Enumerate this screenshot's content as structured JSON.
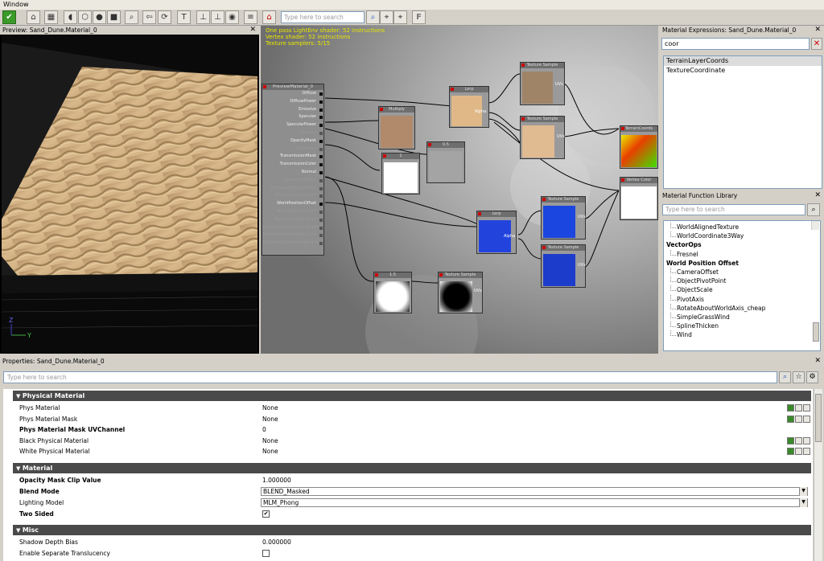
{
  "menu": {
    "window": "Window"
  },
  "toolbar": {
    "search_placeholder": "Type here to search",
    "f_label": "F"
  },
  "preview": {
    "title": "Preview: Sand_Dune.Material_0",
    "axis_y": "Y",
    "axis_z": "Z"
  },
  "graph": {
    "stats": [
      "One pass LightEnv shader: 52 instructions",
      "Vertex shader: 52 instructions",
      "Texture samplers: 5/15"
    ],
    "main_node": {
      "title": "PreviewMaterial_0",
      "inputs": [
        {
          "label": "Diffuse",
          "active": true
        },
        {
          "label": "DiffusePower",
          "active": true
        },
        {
          "label": "Emissive",
          "active": true
        },
        {
          "label": "Specular",
          "active": true
        },
        {
          "label": "SpecularPower",
          "active": true
        },
        {
          "label": "Opacity",
          "active": false
        },
        {
          "label": "OpacityMask",
          "active": true
        },
        {
          "label": "Distortion",
          "active": false
        },
        {
          "label": "TransmissionMask",
          "active": true
        },
        {
          "label": "TransmissionColor",
          "active": true
        },
        {
          "label": "Normal",
          "active": true
        },
        {
          "label": "CustomLighting",
          "active": false
        },
        {
          "label": "CustomLightingDiffuse",
          "active": false
        },
        {
          "label": "AnisotropicDirection",
          "active": false
        },
        {
          "label": "WorldPositionOffset",
          "active": true
        },
        {
          "label": "WorldDisplacement",
          "active": false
        },
        {
          "label": "TessellationMultiplier",
          "active": false
        },
        {
          "label": "SubsurfaceInscatteringColor",
          "active": false
        },
        {
          "label": "SubsurfaceAbsorptionColor",
          "active": false
        },
        {
          "label": "SubsurfaceScatteringRadius",
          "active": false
        }
      ]
    },
    "nodes": {
      "multiply": "Multiply",
      "const1": "1",
      "const05": "0.5",
      "lerp_top": "Lerp",
      "lerp_top_alpha": "Alpha",
      "tex_top": "Texture Sample",
      "tex_mid": "Texture Sample",
      "uvs": "UVs",
      "terrain_coords": "TerrainCoords",
      "vertex_color": "Vertex Color",
      "lerp_bottom": "Lerp",
      "lerp_bottom_alpha": "Alpha",
      "tex_blue_top": "Texture Sample",
      "tex_blue_bottom": "Texture Sample",
      "const_bottom": "1.5",
      "tex_mask": "Texture Sample"
    }
  },
  "expressions": {
    "title": "Material Expressions: Sand_Dune.Material_0",
    "search_value": "coor",
    "results": [
      "TerrainLayerCoords",
      "TextureCoordinate"
    ]
  },
  "function_library": {
    "title": "Material Function Library",
    "search_placeholder": "Type here to search",
    "items": [
      {
        "label": "WorldAlignedTexture",
        "type": "item"
      },
      {
        "label": "WorldCoordinate3Way",
        "type": "item"
      },
      {
        "label": "VectorOps",
        "type": "cat"
      },
      {
        "label": "Fresnel",
        "type": "item"
      },
      {
        "label": "World Position Offset",
        "type": "cat"
      },
      {
        "label": "CameraOffset",
        "type": "item"
      },
      {
        "label": "ObjectPivotPoint",
        "type": "item"
      },
      {
        "label": "ObjectScale",
        "type": "item"
      },
      {
        "label": "PivotAxis",
        "type": "item"
      },
      {
        "label": "RotateAboutWorldAxis_cheap",
        "type": "item"
      },
      {
        "label": "SimpleGrassWind",
        "type": "item"
      },
      {
        "label": "SplineThicken",
        "type": "item"
      },
      {
        "label": "Wind",
        "type": "item"
      }
    ]
  },
  "properties": {
    "title": "Properties: Sand_Dune.Material_0",
    "search_placeholder": "Type here to search",
    "sections": {
      "physical": "Physical Material",
      "material": "Material",
      "misc": "Misc"
    },
    "rows": {
      "phys_material": {
        "name": "Phys Material",
        "value": "None"
      },
      "phys_mask": {
        "name": "Phys Material Mask",
        "value": "None"
      },
      "phys_mask_uv": {
        "name": "Phys Material Mask UVChannel",
        "value": "0"
      },
      "black_phys": {
        "name": "Black Physical Material",
        "value": "None"
      },
      "white_phys": {
        "name": "White Physical Material",
        "value": "None"
      },
      "opacity_clip": {
        "name": "Opacity Mask Clip Value",
        "value": "1.000000"
      },
      "blend_mode": {
        "name": "Blend Mode",
        "value": "BLEND_Masked"
      },
      "lighting_model": {
        "name": "Lighting Model",
        "value": "MLM_Phong"
      },
      "two_sided": {
        "name": "Two Sided",
        "value": "✔"
      },
      "shadow_depth": {
        "name": "Shadow Depth Bias",
        "value": "0.000000"
      },
      "separate_trans": {
        "name": "Enable Separate Translucency",
        "value": ""
      }
    }
  },
  "colors": {
    "accent_green": "#3a9a2a",
    "sand": "#d7b68a",
    "blue_tex": "#1a3ccf",
    "section_bg": "#4a4a4a"
  }
}
